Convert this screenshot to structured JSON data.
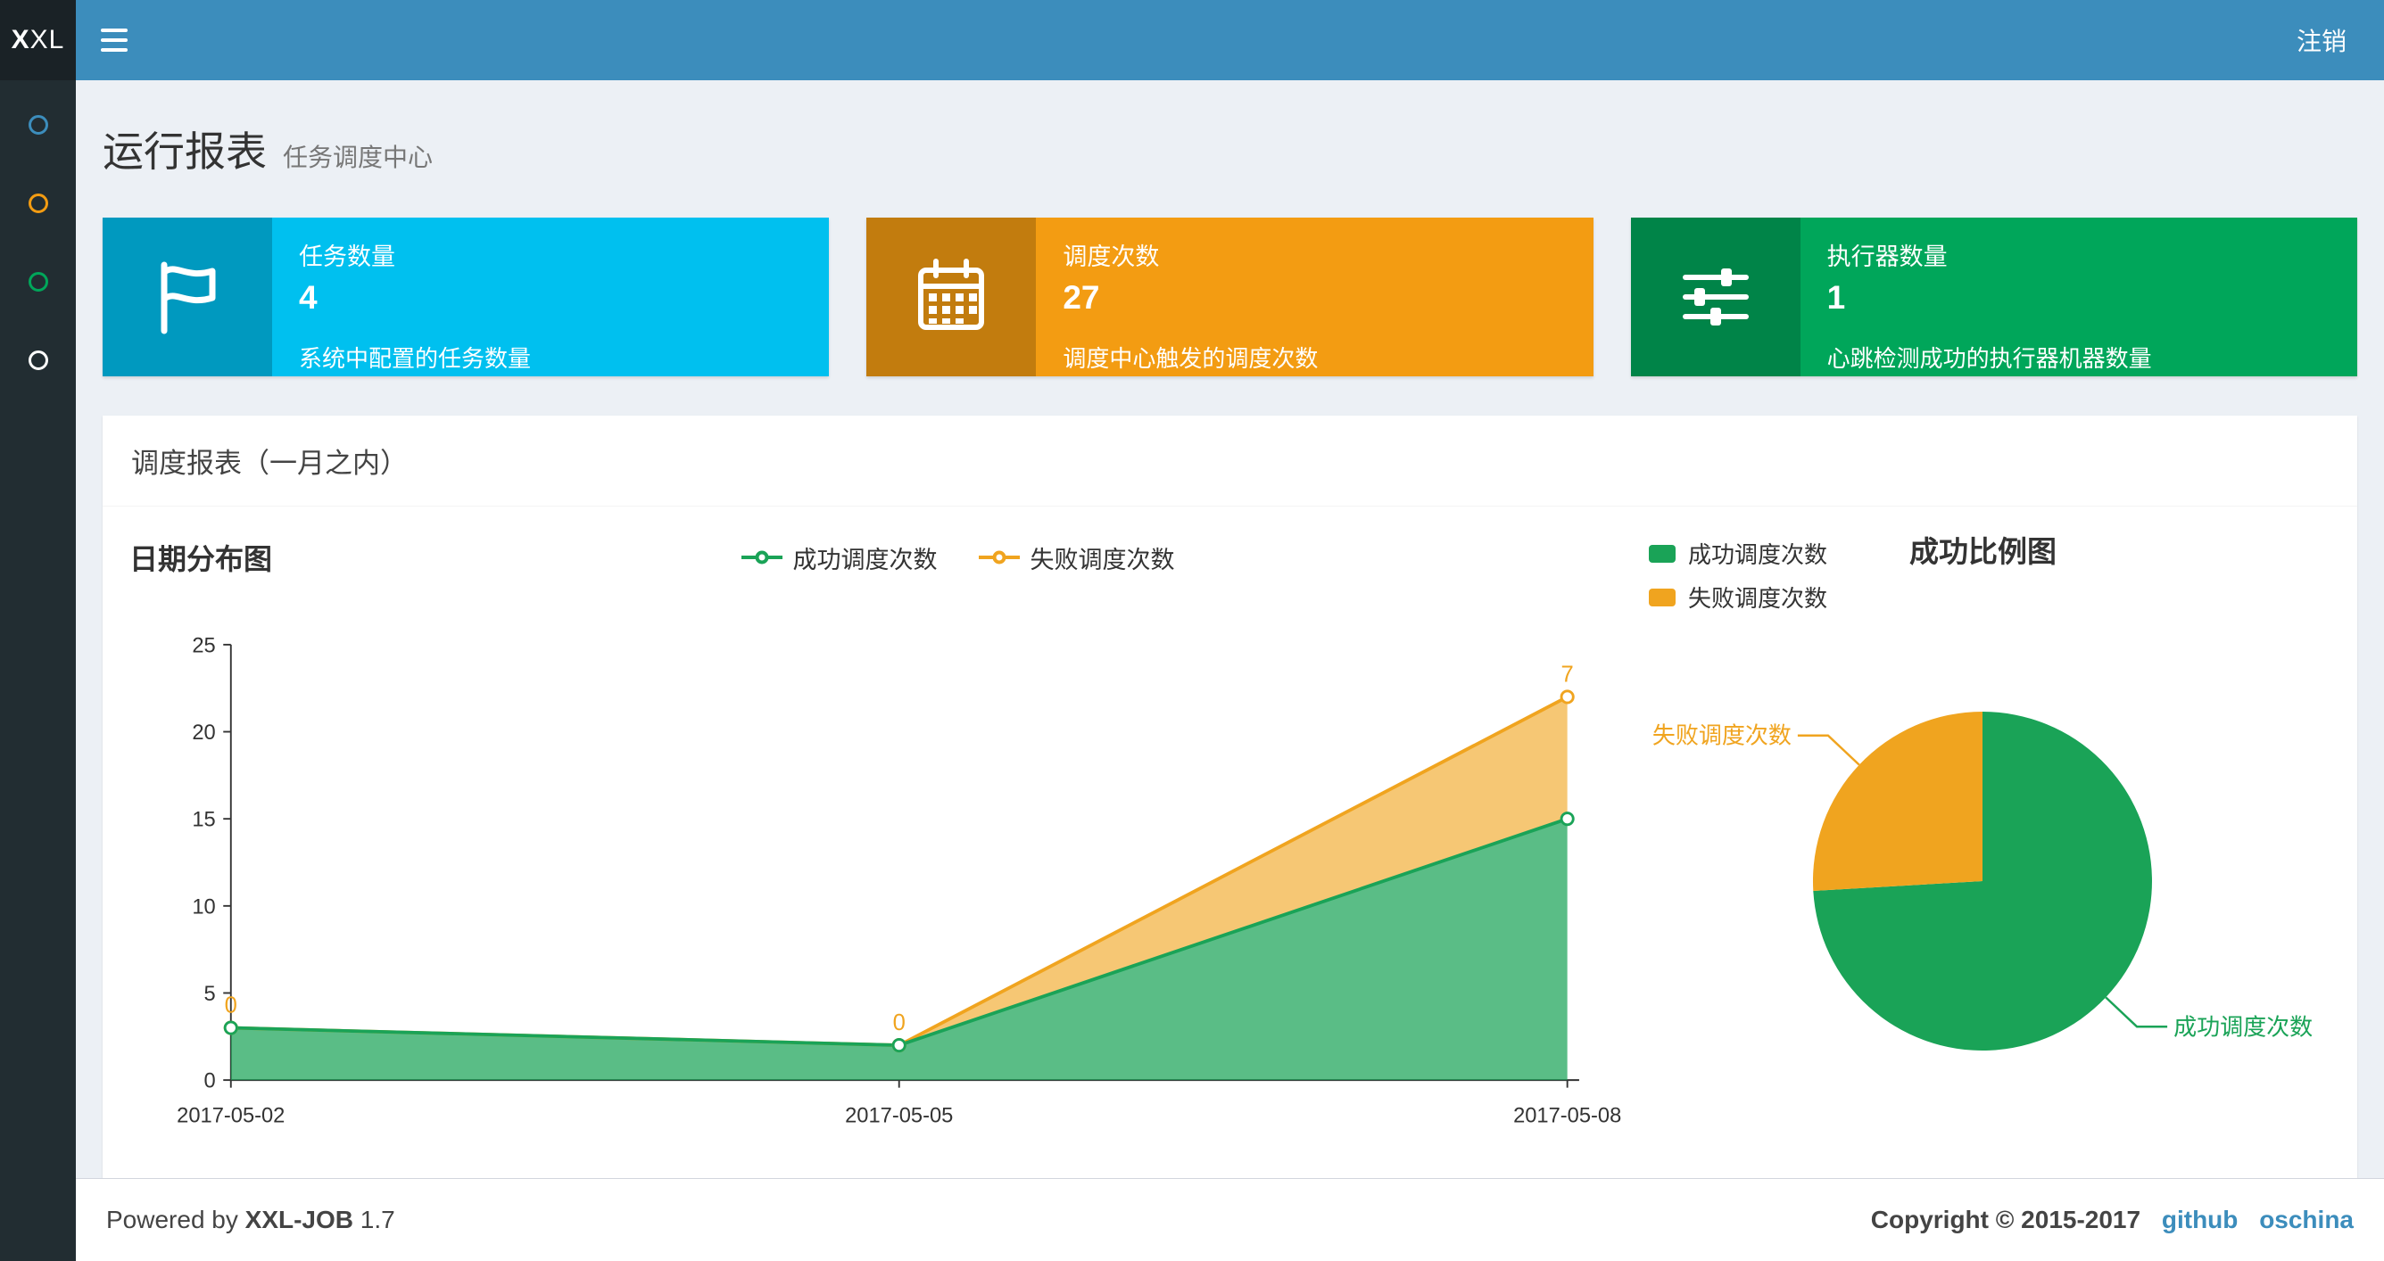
{
  "navbar": {
    "logo_bold": "X",
    "logo_light": "XL",
    "logout": "注销",
    "color": "#3c8dbc",
    "logo_bg": "#1a2226"
  },
  "sidebar": {
    "bg": "#222d32",
    "items": [
      {
        "name": "menu-item-1",
        "color": "#3c8dbc"
      },
      {
        "name": "menu-item-2",
        "color": "#f39c12"
      },
      {
        "name": "menu-item-3",
        "color": "#00a65a"
      },
      {
        "name": "menu-item-4",
        "color": "#ffffff"
      }
    ]
  },
  "page": {
    "title": "运行报表",
    "subtitle": "任务调度中心"
  },
  "info_boxes": [
    {
      "title": "任务数量",
      "number": "4",
      "description": "系统中配置的任务数量",
      "color": "#00c0ef",
      "icon": "flag-icon"
    },
    {
      "title": "调度次数",
      "number": "27",
      "description": "调度中心触发的调度次数",
      "color": "#f39c12",
      "icon": "calendar-icon"
    },
    {
      "title": "执行器数量",
      "number": "1",
      "description": "心跳检测成功的执行器机器数量",
      "color": "#00a65a",
      "icon": "sliders-icon"
    }
  ],
  "panel": {
    "title": "调度报表（一月之内）"
  },
  "chart_data": [
    {
      "type": "area",
      "title": "日期分布图",
      "x": [
        "2017-05-02",
        "2017-05-05",
        "2017-05-08"
      ],
      "ylim": [
        0,
        25
      ],
      "yticks": [
        0,
        5,
        10,
        15,
        20,
        25
      ],
      "stacked": true,
      "grid": false,
      "legend_position": "top",
      "series": [
        {
          "name": "成功调度次数",
          "values": [
            3,
            2,
            15
          ],
          "color": "#1aa357"
        },
        {
          "name": "失败调度次数",
          "values": [
            0,
            0,
            7
          ],
          "color": "#f0a41f",
          "point_labels": [
            "0",
            "0",
            "7"
          ]
        }
      ]
    },
    {
      "type": "pie",
      "title": "成功比例图",
      "legend_position": "top-left",
      "slices": [
        {
          "label": "成功调度次数",
          "value": 20,
          "color": "#1aa357"
        },
        {
          "label": "失败调度次数",
          "value": 7,
          "color": "#f0a41f"
        }
      ]
    }
  ],
  "footer": {
    "powered_prefix": "Powered by",
    "product": "XXL-JOB",
    "version": "1.7",
    "copyright": "Copyright © 2015-2017",
    "links": [
      {
        "label": "github"
      },
      {
        "label": "oschina"
      }
    ]
  }
}
